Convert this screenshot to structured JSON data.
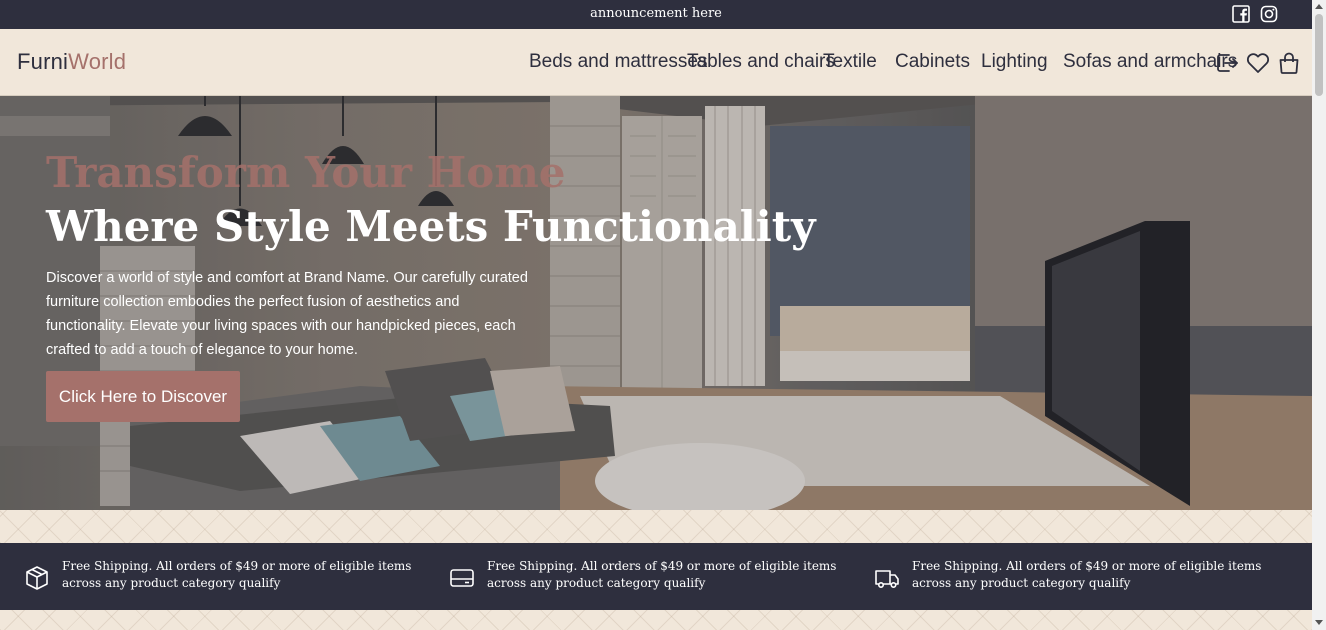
{
  "announcement": {
    "text": "announcement here",
    "icons": [
      "facebook-icon",
      "instagram-icon"
    ]
  },
  "header": {
    "logo": {
      "part1": "Furni",
      "part2": "World"
    },
    "nav": [
      "Beds and mattresses",
      "Tables and chairs",
      "Textile",
      "Cabinets",
      "Lighting",
      "Sofas and armchairs"
    ],
    "icons": [
      "logout-icon",
      "heart-icon",
      "shopping-bag-icon"
    ]
  },
  "hero": {
    "title1": "Transform Your Home",
    "title2": "Where Style Meets Functionality",
    "description": "Discover a world of style and comfort at Brand Name. Our carefully curated furniture collection embodies the perfect fusion of aesthetics and functionality. Elevate your living spaces with our handpicked pieces, each crafted to add a touch of elegance to your home.",
    "button": "Click Here to Discover"
  },
  "features": [
    {
      "icon": "box-icon",
      "text": "Free Shipping. All orders of $49 or more of eligible items across any product category qualify"
    },
    {
      "icon": "credit-card-icon",
      "text": "Free Shipping. All orders of $49 or more of eligible items across any product category qualify"
    },
    {
      "icon": "truck-icon",
      "text": "Free Shipping. All orders of $49 or more of eligible items across any product category qualify"
    }
  ],
  "colors": {
    "dark": "#2e2f3e",
    "accent": "#a5716b",
    "background": "#f1e7da"
  }
}
